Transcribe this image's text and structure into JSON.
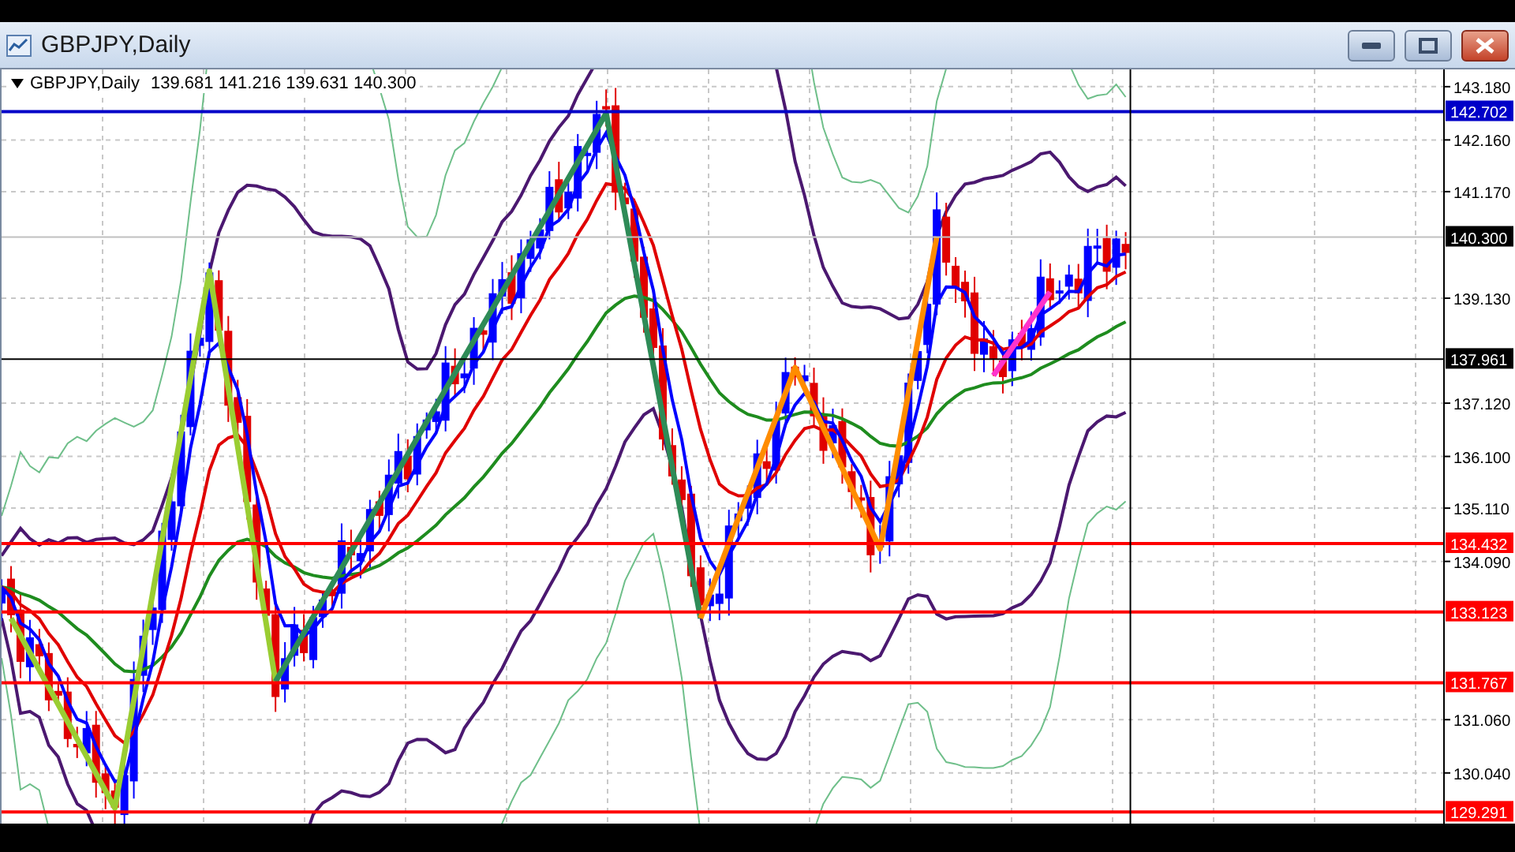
{
  "window": {
    "title": "GBPJPY,Daily"
  },
  "legend": {
    "symbol": "GBPJPY,Daily",
    "values": "139.681 141.216 139.631 140.300"
  },
  "price_axis": {
    "labels": [
      "143.180",
      "142.160",
      "141.170",
      "139.130",
      "137.120",
      "136.100",
      "135.110",
      "134.090",
      "131.060",
      "130.040"
    ]
  },
  "price_lines": [
    {
      "label": "142.702",
      "kind": "level",
      "color": "#0000c8"
    },
    {
      "label": "140.300",
      "kind": "bid",
      "color": "#000000"
    },
    {
      "label": "137.961",
      "kind": "crosshair",
      "color": "#000000"
    },
    {
      "label": "134.432",
      "kind": "level",
      "color": "#ff0000"
    },
    {
      "label": "133.123",
      "kind": "level",
      "color": "#ff0000"
    },
    {
      "label": "131.767",
      "kind": "level",
      "color": "#ff0000"
    },
    {
      "label": "129.291",
      "kind": "level",
      "color": "#ff0000"
    }
  ]
}
